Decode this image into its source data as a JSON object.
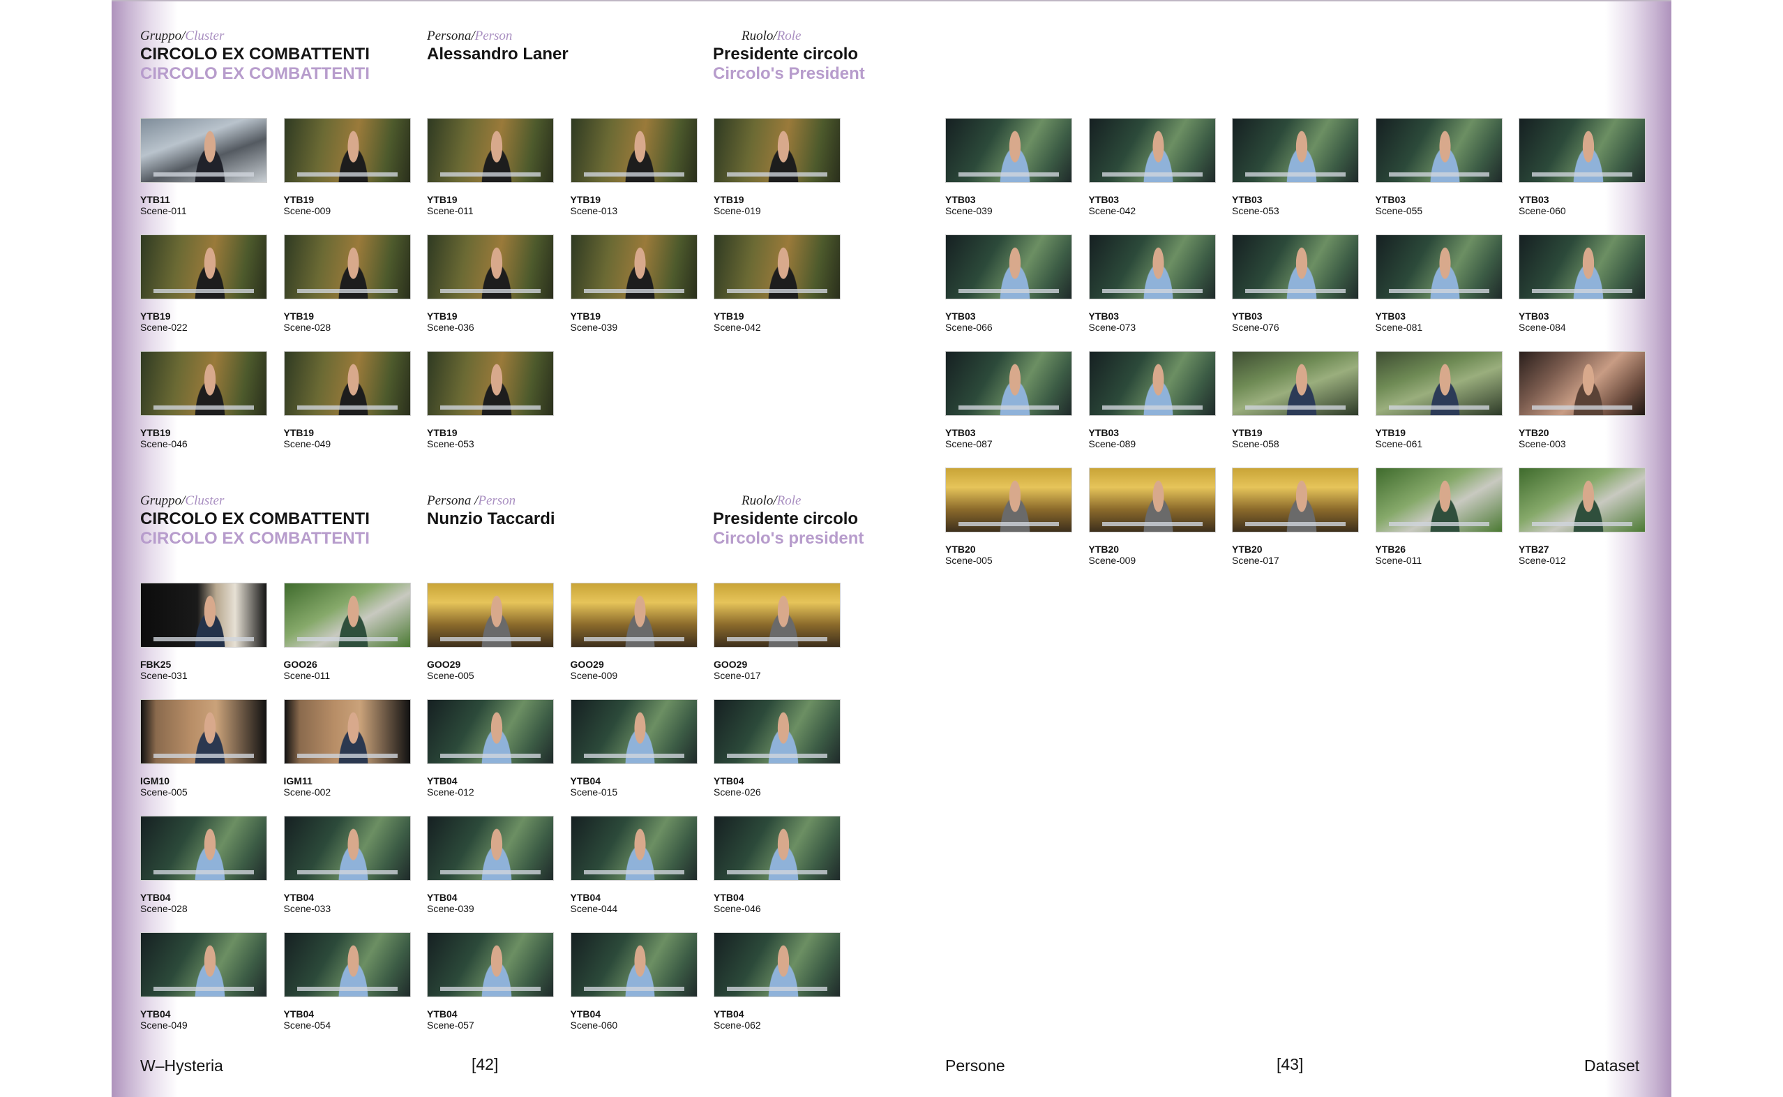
{
  "labels": {
    "cluster_it": "Gruppo/",
    "cluster_en": "Cluster",
    "person_it": "Persona/",
    "person_en": "Person",
    "person_it_spaced": "Persona /",
    "role_it": "Ruolo/",
    "role_en": "Role"
  },
  "sections": [
    {
      "cluster": "CIRCOLO EX COMBATTENTI",
      "cluster_en": "CIRCOLO EX COMBATTENTI",
      "person": "Alessandro Laner",
      "role": "Presidente circolo",
      "role_en": "Circolo's President",
      "thumbs": [
        {
          "code": "YTB11",
          "scene": "Scene-011",
          "style": "street"
        },
        {
          "code": "YTB19",
          "scene": "Scene-009",
          "style": "mic"
        },
        {
          "code": "YTB19",
          "scene": "Scene-011",
          "style": "mic"
        },
        {
          "code": "YTB19",
          "scene": "Scene-013",
          "style": "mic"
        },
        {
          "code": "YTB19",
          "scene": "Scene-019",
          "style": "mic"
        },
        {
          "code": "YTB19",
          "scene": "Scene-022",
          "style": "mic"
        },
        {
          "code": "YTB19",
          "scene": "Scene-028",
          "style": "mic"
        },
        {
          "code": "YTB19",
          "scene": "Scene-036",
          "style": "mic"
        },
        {
          "code": "YTB19",
          "scene": "Scene-039",
          "style": "mic"
        },
        {
          "code": "YTB19",
          "scene": "Scene-042",
          "style": "mic"
        },
        {
          "code": "YTB19",
          "scene": "Scene-046",
          "style": "mic"
        },
        {
          "code": "YTB19",
          "scene": "Scene-049",
          "style": "mic"
        },
        {
          "code": "YTB19",
          "scene": "Scene-053",
          "style": "mic"
        }
      ]
    },
    {
      "cluster": "CIRCOLO EX COMBATTENTI",
      "cluster_en": "CIRCOLO EX COMBATTENTI",
      "person": "Nunzio Taccardi",
      "role": "Presidente circolo",
      "role_en": "Circolo's president",
      "thumbs": [
        {
          "code": "FBK25",
          "scene": "Scene-031",
          "style": "dark"
        },
        {
          "code": "GOO26",
          "scene": "Scene-011",
          "style": "park"
        },
        {
          "code": "GOO29",
          "scene": "Scene-005",
          "style": "cafe"
        },
        {
          "code": "GOO29",
          "scene": "Scene-009",
          "style": "cafe"
        },
        {
          "code": "GOO29",
          "scene": "Scene-017",
          "style": "cafe"
        },
        {
          "code": "IGM10",
          "scene": "Scene-005",
          "style": "wall"
        },
        {
          "code": "IGM11",
          "scene": "Scene-002",
          "style": "wall"
        },
        {
          "code": "YTB04",
          "scene": "Scene-012",
          "style": "garden"
        },
        {
          "code": "YTB04",
          "scene": "Scene-015",
          "style": "garden"
        },
        {
          "code": "YTB04",
          "scene": "Scene-026",
          "style": "garden"
        },
        {
          "code": "YTB04",
          "scene": "Scene-028",
          "style": "garden"
        },
        {
          "code": "YTB04",
          "scene": "Scene-033",
          "style": "garden"
        },
        {
          "code": "YTB04",
          "scene": "Scene-039",
          "style": "garden"
        },
        {
          "code": "YTB04",
          "scene": "Scene-044",
          "style": "garden"
        },
        {
          "code": "YTB04",
          "scene": "Scene-046",
          "style": "garden"
        },
        {
          "code": "YTB04",
          "scene": "Scene-049",
          "style": "garden"
        },
        {
          "code": "YTB04",
          "scene": "Scene-054",
          "style": "garden"
        },
        {
          "code": "YTB04",
          "scene": "Scene-057",
          "style": "garden"
        },
        {
          "code": "YTB04",
          "scene": "Scene-060",
          "style": "garden"
        },
        {
          "code": "YTB04",
          "scene": "Scene-062",
          "style": "garden"
        }
      ]
    },
    {
      "thumbs": [
        {
          "code": "YTB03",
          "scene": "Scene-039",
          "style": "garden"
        },
        {
          "code": "YTB03",
          "scene": "Scene-042",
          "style": "garden"
        },
        {
          "code": "YTB03",
          "scene": "Scene-053",
          "style": "garden"
        },
        {
          "code": "YTB03",
          "scene": "Scene-055",
          "style": "garden"
        },
        {
          "code": "YTB03",
          "scene": "Scene-060",
          "style": "garden"
        },
        {
          "code": "YTB03",
          "scene": "Scene-066",
          "style": "garden"
        },
        {
          "code": "YTB03",
          "scene": "Scene-073",
          "style": "garden"
        },
        {
          "code": "YTB03",
          "scene": "Scene-076",
          "style": "garden"
        },
        {
          "code": "YTB03",
          "scene": "Scene-081",
          "style": "garden"
        },
        {
          "code": "YTB03",
          "scene": "Scene-084",
          "style": "garden"
        },
        {
          "code": "YTB03",
          "scene": "Scene-087",
          "style": "garden"
        },
        {
          "code": "YTB03",
          "scene": "Scene-089",
          "style": "garden"
        },
        {
          "code": "YTB19",
          "scene": "Scene-058",
          "style": "fence"
        },
        {
          "code": "YTB19",
          "scene": "Scene-061",
          "style": "fence"
        },
        {
          "code": "YTB20",
          "scene": "Scene-003",
          "style": "closeup"
        },
        {
          "code": "YTB20",
          "scene": "Scene-005",
          "style": "cafe"
        },
        {
          "code": "YTB20",
          "scene": "Scene-009",
          "style": "cafe"
        },
        {
          "code": "YTB20",
          "scene": "Scene-017",
          "style": "cafe"
        },
        {
          "code": "YTB26",
          "scene": "Scene-011",
          "style": "park"
        },
        {
          "code": "YTB27",
          "scene": "Scene-012",
          "style": "park"
        }
      ]
    }
  ],
  "footer": {
    "left_title": "W–Hysteria",
    "left_page": "[42]",
    "right_section": "Persone",
    "right_page": "[43]",
    "right_title": "Dataset"
  },
  "colors": {
    "accent_purple": "#a98fc1",
    "page_edge_shade": "#ae92bc",
    "text": "#141414"
  }
}
